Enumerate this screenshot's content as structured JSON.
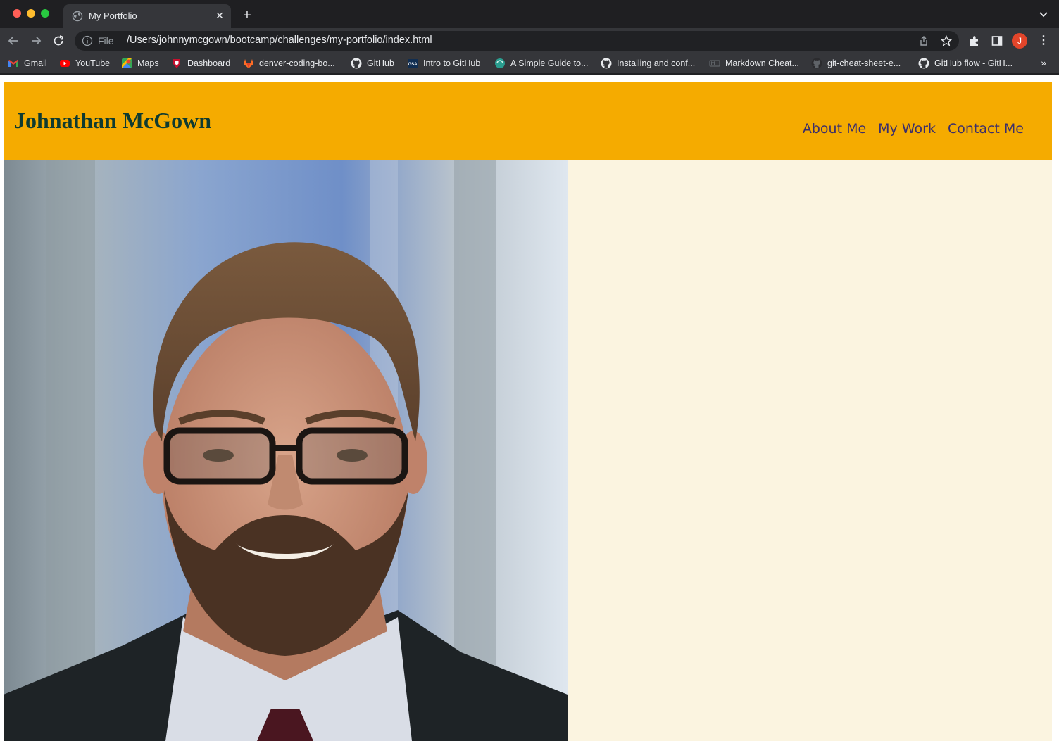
{
  "browser": {
    "tab_title": "My Portfolio",
    "address_scheme_label": "File",
    "url": "/Users/johnnymcgown/bootcamp/challenges/my-portfolio/index.html",
    "profile_initial": "J",
    "bookmarks": [
      {
        "label": "Gmail",
        "icon": "gmail-icon"
      },
      {
        "label": "YouTube",
        "icon": "youtube-icon"
      },
      {
        "label": "Maps",
        "icon": "maps-icon"
      },
      {
        "label": "Dashboard",
        "icon": "dashboard-icon"
      },
      {
        "label": "denver-coding-bo...",
        "icon": "gitlab-icon"
      },
      {
        "label": "GitHub",
        "icon": "github-icon"
      },
      {
        "label": "Intro to GitHub",
        "icon": "gsa-icon"
      },
      {
        "label": "A Simple Guide to...",
        "icon": "guide-icon"
      },
      {
        "label": "Installing and conf...",
        "icon": "github-icon"
      },
      {
        "label": "Markdown Cheat...",
        "icon": "markdown-icon"
      },
      {
        "label": "git-cheat-sheet-e...",
        "icon": "github-icon"
      },
      {
        "label": "GitHub flow - GitH...",
        "icon": "github-icon"
      }
    ]
  },
  "site": {
    "title": "Johnathan McGown",
    "nav": [
      "About Me",
      "My Work",
      "Contact Me"
    ],
    "colors": {
      "header_bg": "#f5ab00",
      "title": "#0e3b31",
      "nav_link": "#3b2e6b",
      "page_bg": "#fbf4e0"
    },
    "portrait": "portrait-photo"
  }
}
